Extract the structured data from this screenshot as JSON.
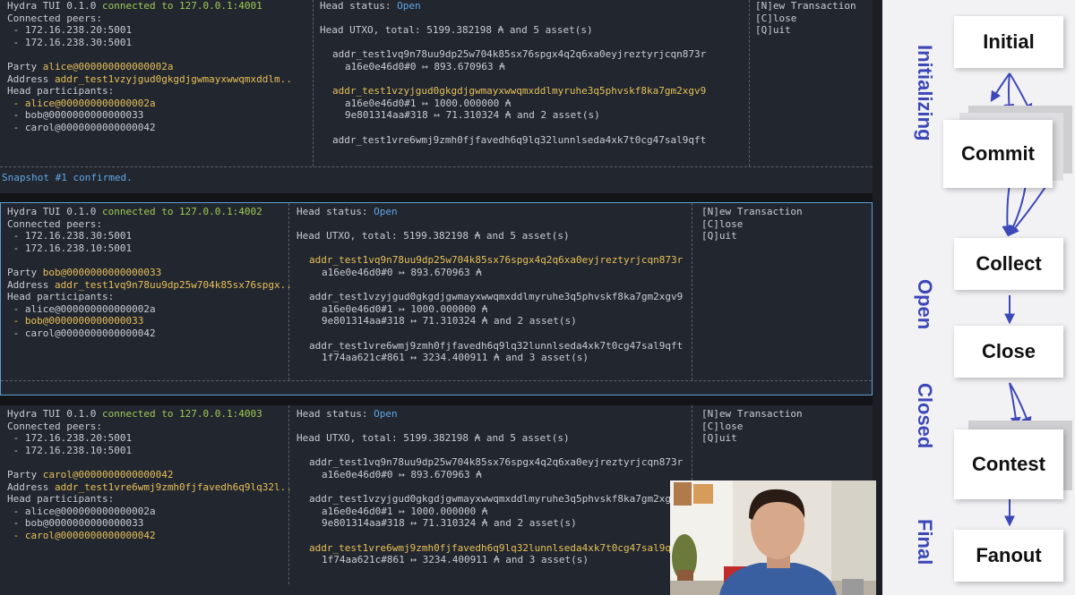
{
  "panes": [
    {
      "tui_version": "Hydra TUI 0.1.0",
      "connected_to": "connected to 127.0.0.1:4001",
      "peers_label": "Connected peers:",
      "peers": [
        " - 172.16.238.20:5001",
        " - 172.16.238.30:5001"
      ],
      "party_label": "Party ",
      "party": "alice@000000000000002a",
      "address_label": "Address ",
      "address": "addr_test1vzyjgud0gkgdjgwmayxwwqmxddlm..",
      "participants_label": "Head participants:",
      "participants": [
        " - alice@000000000000002a",
        " - bob@0000000000000033",
        " - carol@0000000000000042"
      ],
      "head_status_label": "Head status: ",
      "head_status": "Open",
      "utxo_total": "Head UTXO, total: 5199.382198 ₳ and 5 asset(s)",
      "utxos": [
        {
          "address": "addr_test1vq9n78uu9dp25w704k85sx76spgx4q2q6xa0eyjreztyrjcqn873r",
          "entries": [
            "a16e0e46d0#0 ↦ 893.670963 ₳"
          ]
        },
        {
          "address": "addr_test1vzyjgud0gkgdjgwmayxwwqmxddlmyruhe3q5phvskf8ka7gm2xgv9",
          "entries": [
            "a16e0e46d0#1 ↦ 1000.000000 ₳",
            "9e801314aa#318 ↦ 71.310324 ₳ and 2 asset(s)"
          ]
        },
        {
          "address": "addr_test1vre6wmj9zmh0fjfavedh6q9lq32lunnlseda4xk7t0cg47sal9qft",
          "entries": []
        }
      ],
      "menu": [
        "[N]ew Transaction",
        "[C]lose",
        "[Q]uit"
      ],
      "footer": "Snapshot #1 confirmed."
    },
    {
      "tui_version": "Hydra TUI 0.1.0",
      "connected_to": "connected to 127.0.0.1:4002",
      "peers_label": "Connected peers:",
      "peers": [
        " - 172.16.238.30:5001",
        " - 172.16.238.10:5001"
      ],
      "party_label": "Party ",
      "party": "bob@0000000000000033",
      "address_label": "Address ",
      "address": "addr_test1vq9n78uu9dp25w704k85sx76spgx..",
      "participants_label": "Head participants:",
      "participants": [
        " - alice@000000000000002a",
        " - bob@0000000000000033",
        " - carol@0000000000000042"
      ],
      "head_status_label": "Head status: ",
      "head_status": "Open",
      "utxo_total": "Head UTXO, total: 5199.382198 ₳ and 5 asset(s)",
      "utxos": [
        {
          "address": "addr_test1vq9n78uu9dp25w704k85sx76spgx4q2q6xa0eyjreztyrjcqn873r",
          "entries": [
            "a16e0e46d0#0 ↦ 893.670963 ₳"
          ]
        },
        {
          "address": "addr_test1vzyjgud0gkgdjgwmayxwwqmxddlmyruhe3q5phvskf8ka7gm2xgv9",
          "entries": [
            "a16e0e46d0#1 ↦ 1000.000000 ₳",
            "9e801314aa#318 ↦ 71.310324 ₳ and 2 asset(s)"
          ]
        },
        {
          "address": "addr_test1vre6wmj9zmh0fjfavedh6q9lq32lunnlseda4xk7t0cg47sal9qft",
          "entries": [
            "1f74aa621c#861 ↦ 3234.400911 ₳ and 3 asset(s)"
          ]
        }
      ],
      "menu": [
        "[N]ew Transaction",
        "[C]lose",
        "[Q]uit"
      ],
      "footer": ""
    },
    {
      "tui_version": "Hydra TUI 0.1.0",
      "connected_to": "connected to 127.0.0.1:4003",
      "peers_label": "Connected peers:",
      "peers": [
        " - 172.16.238.20:5001",
        " - 172.16.238.10:5001"
      ],
      "party_label": "Party ",
      "party": "carol@0000000000000042",
      "address_label": "Address ",
      "address": "addr_test1vre6wmj9zmh0fjfavedh6q9lq32l..",
      "participants_label": "Head participants:",
      "participants": [
        " - alice@000000000000002a",
        " - bob@0000000000000033",
        " - carol@0000000000000042"
      ],
      "head_status_label": "Head status: ",
      "head_status": "Open",
      "utxo_total": "Head UTXO, total: 5199.382198 ₳ and 5 asset(s)",
      "utxos": [
        {
          "address": "addr_test1vq9n78uu9dp25w704k85sx76spgx4q2q6xa0eyjreztyrjcqn873r",
          "entries": [
            "a16e0e46d0#0 ↦ 893.670963 ₳"
          ]
        },
        {
          "address": "addr_test1vzyjgud0gkgdjgwmayxwwqmxddlmyruhe3q5phvskf8ka7gm2xgv9",
          "entries": [
            "a16e0e46d0#1 ↦ 1000.000000 ₳",
            "9e801314aa#318 ↦ 71.310324 ₳ and 2 asset(s)"
          ]
        },
        {
          "address": "addr_test1vre6wmj9zmh0fjfavedh6q9lq32lunnlseda4xk7t0cg47sal9qft",
          "entries": [
            "1f74aa621c#861 ↦ 3234.400911 ₳ and 3 asset(s)"
          ]
        }
      ],
      "menu": [
        "[N]ew Transaction",
        "[C]lose",
        "[Q]uit"
      ],
      "footer": ""
    }
  ],
  "diagram": {
    "states": [
      "Initial",
      "Commit",
      "Collect",
      "Close",
      "Contest",
      "Fanout"
    ],
    "phases": [
      "Initializing",
      "Open",
      "Closed",
      "Final"
    ]
  },
  "colors": {
    "accent_green": "#9fca56",
    "accent_yellow": "#e6c05a",
    "accent_blue": "#5fa8e8",
    "diagram_text": "#3d48b8",
    "active_border": "#5aa0d8"
  }
}
